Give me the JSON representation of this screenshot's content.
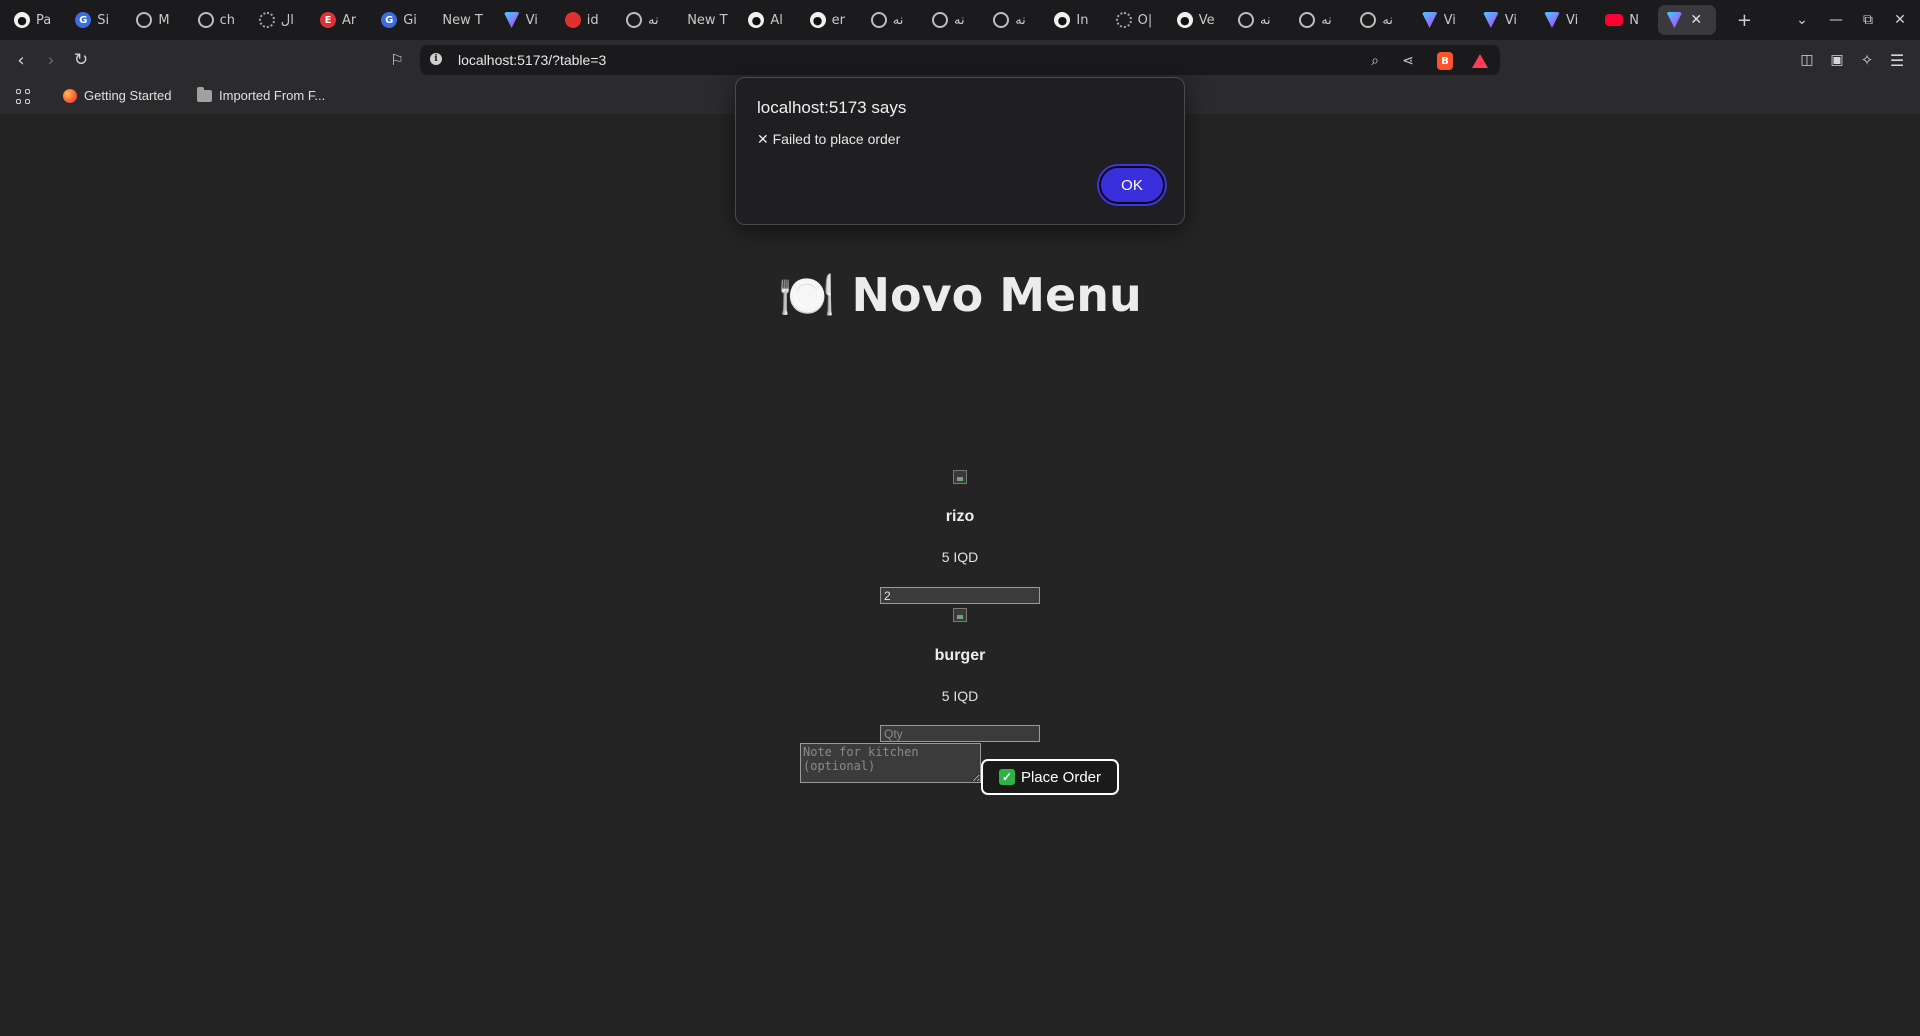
{
  "browser": {
    "tabs": [
      {
        "title": "Pa",
        "icon": "github-icon"
      },
      {
        "title": "Si",
        "icon": "google-icon"
      },
      {
        "title": "M",
        "icon": "globe-icon"
      },
      {
        "title": "ch",
        "icon": "globe-icon"
      },
      {
        "title": "ال",
        "icon": "loading-icon"
      },
      {
        "title": "Ar",
        "icon": "e-icon"
      },
      {
        "title": "Gi",
        "icon": "translate-icon"
      },
      {
        "title": "New T",
        "icon": ""
      },
      {
        "title": "Vi",
        "icon": "vite-icon"
      },
      {
        "title": "id",
        "icon": "red-icon"
      },
      {
        "title": "نه",
        "icon": "globe-icon"
      },
      {
        "title": "New T",
        "icon": ""
      },
      {
        "title": "Al",
        "icon": "github-icon"
      },
      {
        "title": "er",
        "icon": "github-icon"
      },
      {
        "title": "نه",
        "icon": "globe-icon"
      },
      {
        "title": "نه",
        "icon": "globe-icon"
      },
      {
        "title": "نه",
        "icon": "globe-icon"
      },
      {
        "title": "In",
        "icon": "github-icon"
      },
      {
        "title": "O|",
        "icon": "openai-icon"
      },
      {
        "title": "Ve",
        "icon": "github-icon"
      },
      {
        "title": "نه",
        "icon": "globe-icon"
      },
      {
        "title": "نه",
        "icon": "globe-icon"
      },
      {
        "title": "نه",
        "icon": "globe-icon"
      },
      {
        "title": "Vi",
        "icon": "vite-icon"
      },
      {
        "title": "Vi",
        "icon": "vite-icon"
      },
      {
        "title": "Vi",
        "icon": "vite-icon"
      },
      {
        "title": "N",
        "icon": "youtube-icon"
      }
    ],
    "url": "localhost:5173/?table=3",
    "bookmarks": [
      {
        "label": "Getting Started",
        "icon": "firefox-icon"
      },
      {
        "label": "Imported From F...",
        "icon": "folder-icon"
      }
    ]
  },
  "dialog": {
    "origin": "localhost:5173 says",
    "message": "✕ Failed to place order",
    "ok_label": "OK"
  },
  "page": {
    "title": "Novo Menu",
    "title_emoji": "🍽️",
    "items": [
      {
        "name": "rizo",
        "price": "5 IQD",
        "qty_value": "2",
        "qty_placeholder": "Qty"
      },
      {
        "name": "burger",
        "price": "5 IQD",
        "qty_value": "",
        "qty_placeholder": "Qty"
      }
    ],
    "note_placeholder": "Note for kitchen (optional)",
    "place_order_label": "Place Order"
  },
  "colors": {
    "background": "#242424",
    "ok_button": "#3a2fdd",
    "check_emoji": "#2fb344"
  }
}
